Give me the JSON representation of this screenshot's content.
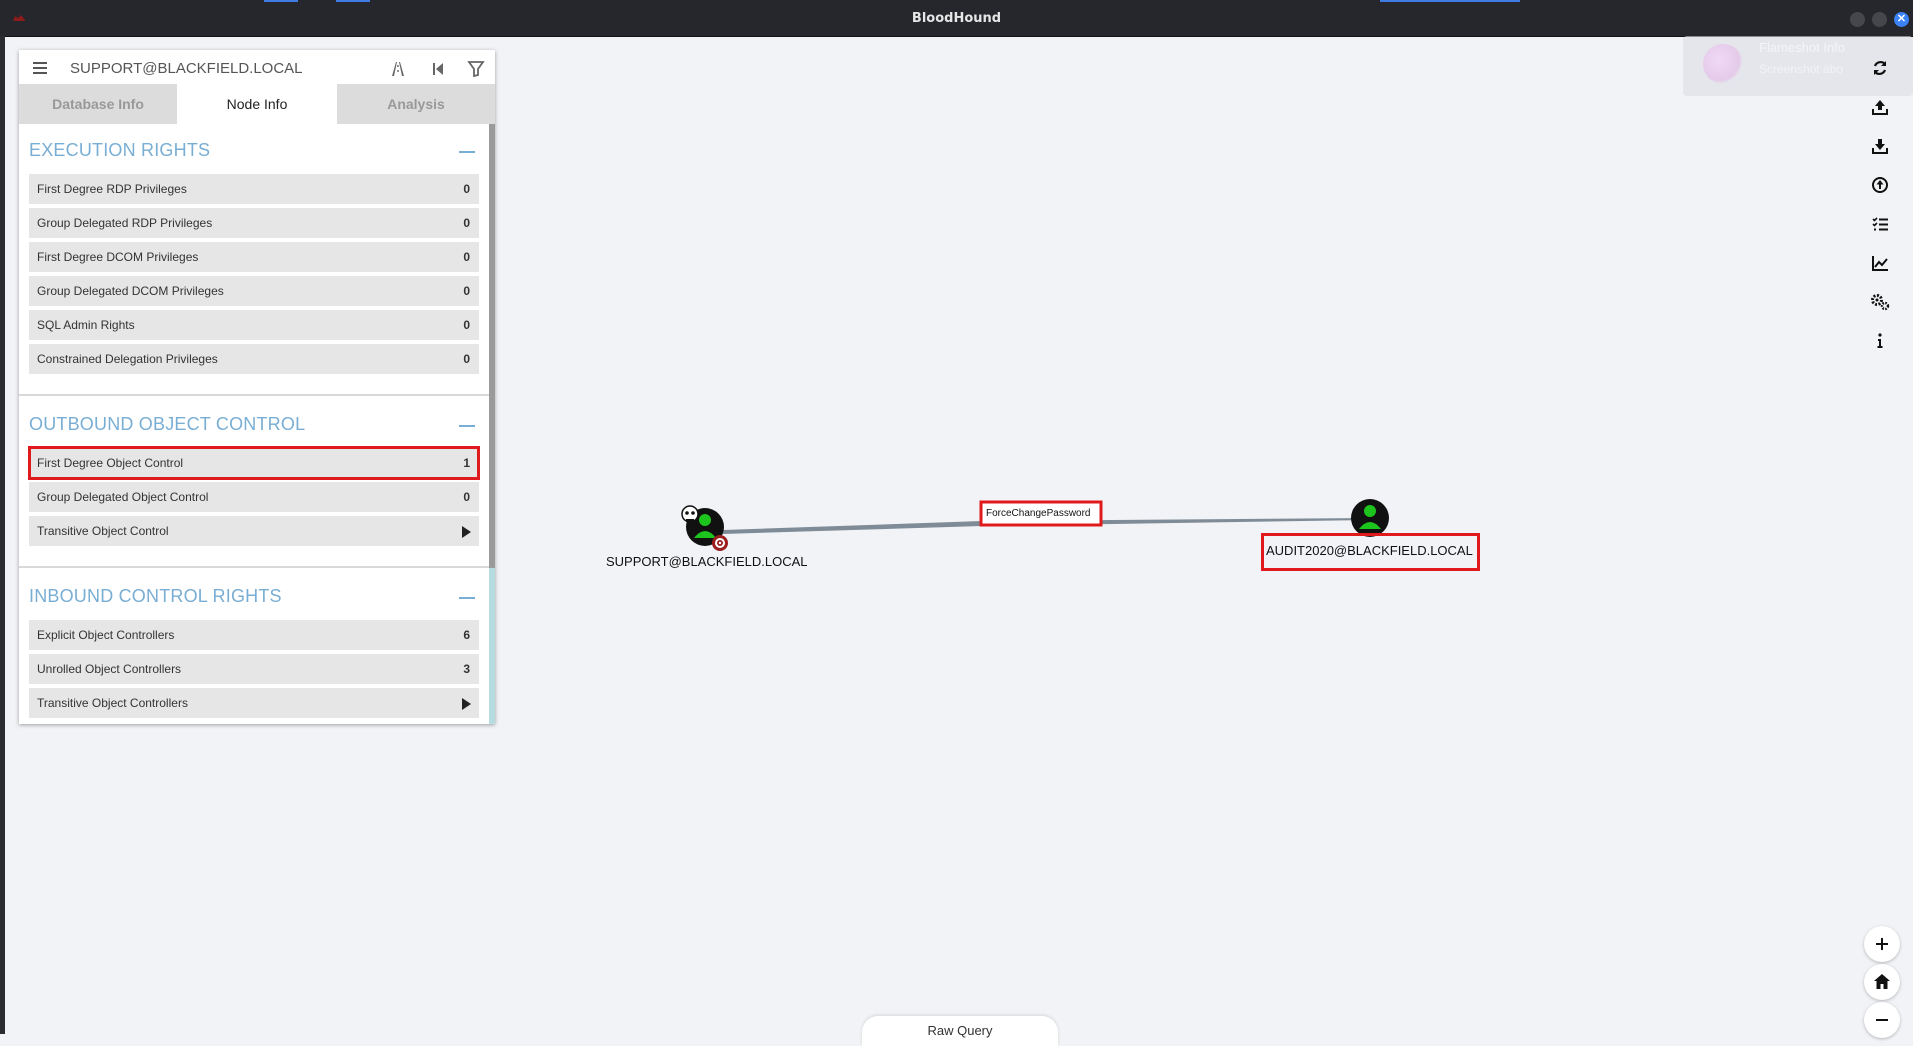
{
  "window": {
    "title": "BloodHound"
  },
  "search": {
    "value": "SUPPORT@BLACKFIELD.LOCAL"
  },
  "tabs": [
    {
      "label": "Database Info"
    },
    {
      "label": "Node Info"
    },
    {
      "label": "Analysis"
    }
  ],
  "sections": {
    "execution": {
      "title": "EXECUTION RIGHTS",
      "rows": [
        {
          "label": "First Degree RDP Privileges",
          "value": "0"
        },
        {
          "label": "Group Delegated RDP Privileges",
          "value": "0"
        },
        {
          "label": "First Degree DCOM Privileges",
          "value": "0"
        },
        {
          "label": "Group Delegated DCOM Privileges",
          "value": "0"
        },
        {
          "label": "SQL Admin Rights",
          "value": "0"
        },
        {
          "label": "Constrained Delegation Privileges",
          "value": "0"
        }
      ]
    },
    "outbound": {
      "title": "OUTBOUND OBJECT CONTROL",
      "rows": [
        {
          "label": "First Degree Object Control",
          "value": "1"
        },
        {
          "label": "Group Delegated Object Control",
          "value": "0"
        },
        {
          "label": "Transitive Object Control"
        }
      ]
    },
    "inbound": {
      "title": "INBOUND CONTROL RIGHTS",
      "rows": [
        {
          "label": "Explicit Object Controllers",
          "value": "6"
        },
        {
          "label": "Unrolled Object Controllers",
          "value": "3"
        },
        {
          "label": "Transitive Object Controllers"
        }
      ]
    }
  },
  "graph": {
    "source": {
      "label": "SUPPORT@BLACKFIELD.LOCAL"
    },
    "edge": {
      "label": "ForceChangePassword"
    },
    "target": {
      "label": "AUDIT2020@BLACKFIELD.LOCAL"
    }
  },
  "notification": {
    "title": "Flameshot Info",
    "text": "Screenshot abo"
  },
  "raw_query": {
    "label": "Raw Query"
  },
  "colors": {
    "accent": "#79aed4",
    "highlight": "#e0191c",
    "node_green": "#1ec41e"
  }
}
